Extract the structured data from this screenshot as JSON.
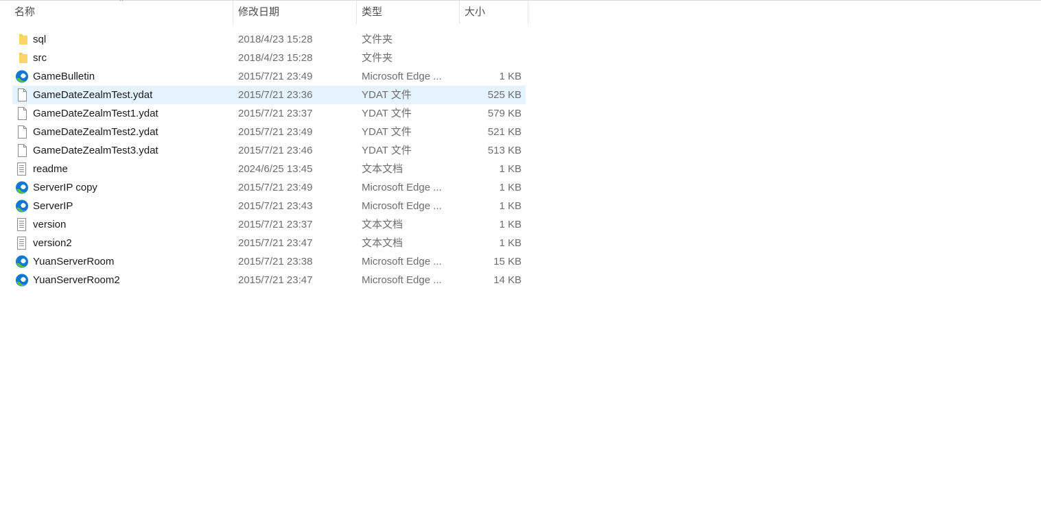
{
  "columns": {
    "name": "名称",
    "date": "修改日期",
    "type": "类型",
    "size": "大小"
  },
  "sort_indicator": "^",
  "selected_row_index": 3,
  "colors": {
    "selected_bg": "#e5f3ff",
    "folder": "#f8c94a",
    "edge_blue": "#0f78d4",
    "edge_green": "#5fc33a"
  },
  "files": [
    {
      "name": "sql",
      "date": "2018/4/23 15:28",
      "type": "文件夹",
      "size": "",
      "icon": "folder-icon"
    },
    {
      "name": "src",
      "date": "2018/4/23 15:28",
      "type": "文件夹",
      "size": "",
      "icon": "folder-icon"
    },
    {
      "name": "GameBulletin",
      "date": "2015/7/21 23:49",
      "type": "Microsoft Edge ...",
      "size": "1 KB",
      "icon": "edge-icon"
    },
    {
      "name": "GameDateZealmTest.ydat",
      "date": "2015/7/21 23:36",
      "type": "YDAT 文件",
      "size": "525 KB",
      "icon": "file-icon"
    },
    {
      "name": "GameDateZealmTest1.ydat",
      "date": "2015/7/21 23:37",
      "type": "YDAT 文件",
      "size": "579 KB",
      "icon": "file-icon"
    },
    {
      "name": "GameDateZealmTest2.ydat",
      "date": "2015/7/21 23:49",
      "type": "YDAT 文件",
      "size": "521 KB",
      "icon": "file-icon"
    },
    {
      "name": "GameDateZealmTest3.ydat",
      "date": "2015/7/21 23:46",
      "type": "YDAT 文件",
      "size": "513 KB",
      "icon": "file-icon"
    },
    {
      "name": "readme",
      "date": "2024/6/25 13:45",
      "type": "文本文档",
      "size": "1 KB",
      "icon": "text-file-icon"
    },
    {
      "name": "ServerIP copy",
      "date": "2015/7/21 23:49",
      "type": "Microsoft Edge ...",
      "size": "1 KB",
      "icon": "edge-icon"
    },
    {
      "name": "ServerIP",
      "date": "2015/7/21 23:43",
      "type": "Microsoft Edge ...",
      "size": "1 KB",
      "icon": "edge-icon"
    },
    {
      "name": "version",
      "date": "2015/7/21 23:37",
      "type": "文本文档",
      "size": "1 KB",
      "icon": "text-file-icon"
    },
    {
      "name": "version2",
      "date": "2015/7/21 23:47",
      "type": "文本文档",
      "size": "1 KB",
      "icon": "text-file-icon"
    },
    {
      "name": "YuanServerRoom",
      "date": "2015/7/21 23:38",
      "type": "Microsoft Edge ...",
      "size": "15 KB",
      "icon": "edge-icon"
    },
    {
      "name": "YuanServerRoom2",
      "date": "2015/7/21 23:47",
      "type": "Microsoft Edge ...",
      "size": "14 KB",
      "icon": "edge-icon"
    }
  ]
}
